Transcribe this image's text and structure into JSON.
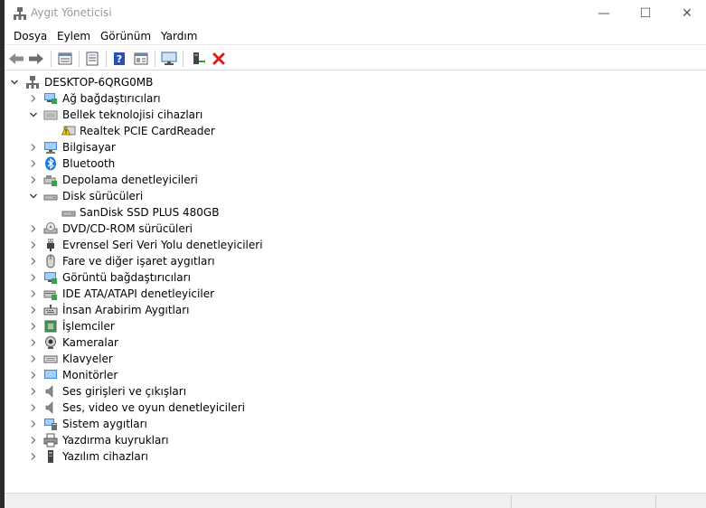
{
  "window": {
    "title": "Aygıt Yöneticisi",
    "minimize_glyph": "—",
    "maximize_glyph": "☐",
    "close_glyph": "✕"
  },
  "menu": [
    "Dosya",
    "Eylem",
    "Görünüm",
    "Yardım"
  ],
  "toolbar": {
    "icons": [
      "back-arrow-icon",
      "forward-arrow-icon",
      "device-list-icon",
      "properties-icon",
      "help-icon",
      "view-icon",
      "computer-monitor-icon",
      "update-driver-icon",
      "uninstall-icon"
    ]
  },
  "tree": {
    "root": {
      "label": "DESKTOP-6QRG0MB",
      "icon": "computer-network-icon"
    },
    "nodes": [
      {
        "label": "Ağ bağdaştırıcıları",
        "icon": "network-adapter-icon",
        "expanded": false
      },
      {
        "label": "Bellek teknolojisi cihazları",
        "icon": "memory-device-icon",
        "expanded": true,
        "children": [
          {
            "label": "Realtek PCIE CardReader",
            "icon": "warning-icon"
          }
        ]
      },
      {
        "label": "Bilgisayar",
        "icon": "computer-icon",
        "expanded": false
      },
      {
        "label": "Bluetooth",
        "icon": "bluetooth-icon",
        "expanded": false
      },
      {
        "label": "Depolama denetleyicileri",
        "icon": "storage-controller-icon",
        "expanded": false
      },
      {
        "label": "Disk sürücüleri",
        "icon": "disk-drive-icon",
        "expanded": true,
        "children": [
          {
            "label": "SanDisk SSD PLUS 480GB",
            "icon": "disk-drive-icon"
          }
        ]
      },
      {
        "label": "DVD/CD-ROM sürücüleri",
        "icon": "dvd-drive-icon",
        "expanded": false
      },
      {
        "label": "Evrensel Seri Veri Yolu denetleyicileri",
        "icon": "usb-icon",
        "expanded": false
      },
      {
        "label": "Fare ve diğer işaret aygıtları",
        "icon": "mouse-icon",
        "expanded": false
      },
      {
        "label": "Görüntü bağdaştırıcıları",
        "icon": "display-adapter-icon",
        "expanded": false
      },
      {
        "label": "IDE ATA/ATAPI denetleyiciler",
        "icon": "ide-controller-icon",
        "expanded": false
      },
      {
        "label": "İnsan Arabirim Aygıtları",
        "icon": "hid-icon",
        "expanded": false
      },
      {
        "label": "İşlemciler",
        "icon": "processor-icon",
        "expanded": false
      },
      {
        "label": "Kameralar",
        "icon": "camera-icon",
        "expanded": false
      },
      {
        "label": "Klavyeler",
        "icon": "keyboard-icon",
        "expanded": false
      },
      {
        "label": "Monitörler",
        "icon": "monitor-icon",
        "expanded": false
      },
      {
        "label": "Ses girişleri ve çıkışları",
        "icon": "speaker-icon",
        "expanded": false
      },
      {
        "label": "Ses, video ve oyun denetleyicileri",
        "icon": "sound-controller-icon",
        "expanded": false
      },
      {
        "label": "Sistem aygıtları",
        "icon": "system-devices-icon",
        "expanded": false
      },
      {
        "label": "Yazdırma kuyrukları",
        "icon": "printer-icon",
        "expanded": false
      },
      {
        "label": "Yazılım cihazları",
        "icon": "software-device-icon",
        "expanded": false
      }
    ]
  },
  "colors": {
    "accent": "#1e7bd4",
    "warning": "#f2c811",
    "uninstall_red": "#d9201c",
    "update_green": "#2e9c3a"
  }
}
